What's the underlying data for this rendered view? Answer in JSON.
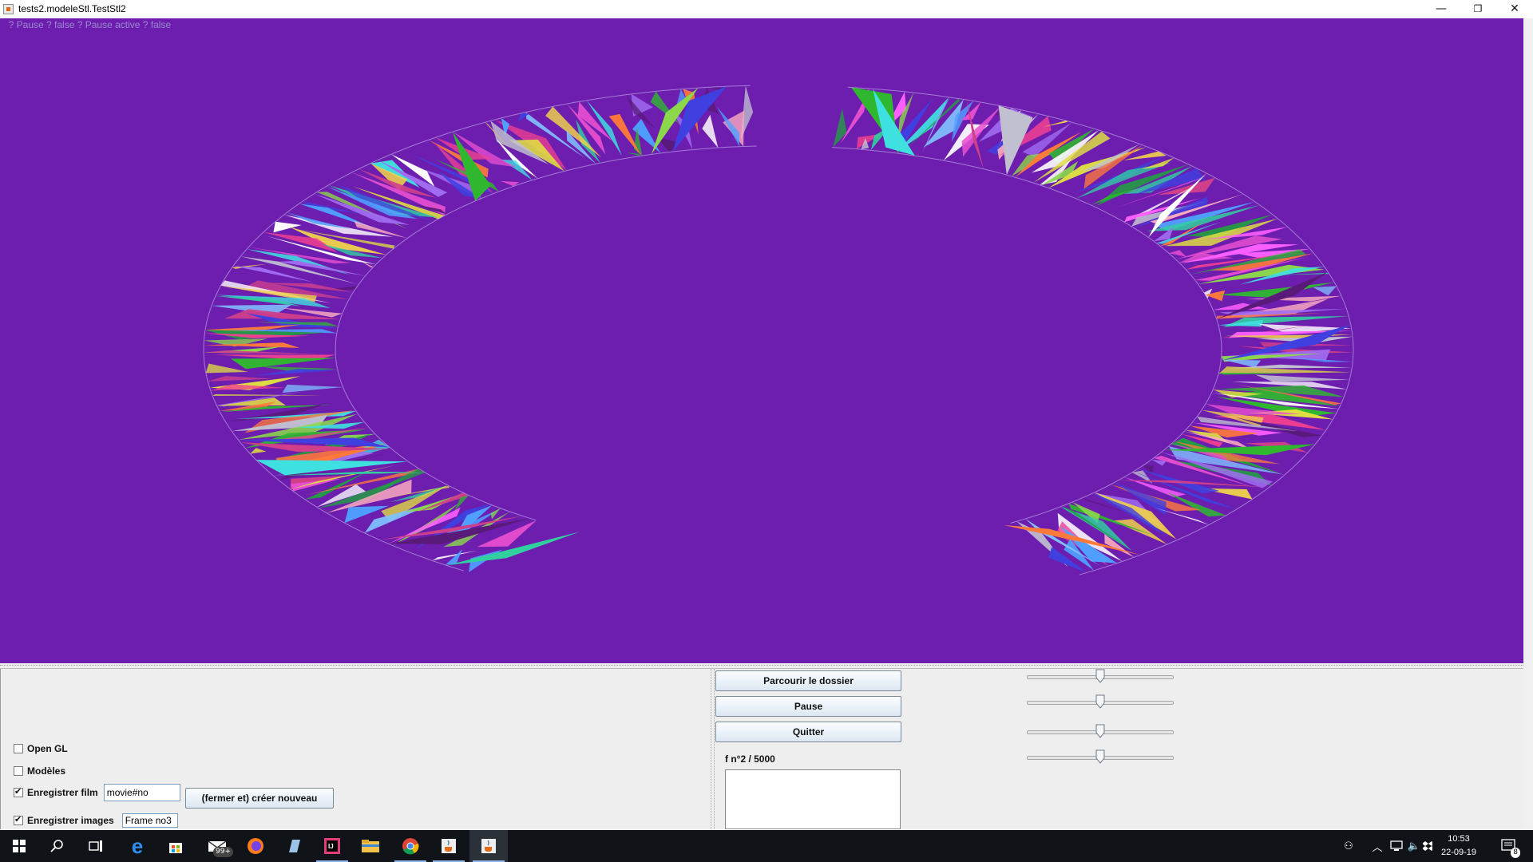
{
  "window": {
    "title": "tests2.modeleStl.TestStl2",
    "minimize": "—",
    "maximize": "❐",
    "close": "✕"
  },
  "canvas": {
    "background": "#6d1eaf",
    "hud_text": "  ? Pause ? false ? Pause active ? false"
  },
  "panel": {
    "checkboxes": [
      {
        "label": "Open GL",
        "checked": false
      },
      {
        "label": "Modèles",
        "checked": false
      },
      {
        "label": "Enregistrer film",
        "checked": true
      },
      {
        "label": "Enregistrer images",
        "checked": true
      }
    ],
    "movie_field": "movie#no",
    "frame_field": "Frame no3",
    "new_button": "(fermer et) créer nouveau",
    "browse_button": "Parcourir le dossier",
    "pause_button": "Pause",
    "quit_button": "Quitter",
    "frame_counter": "f n°2 / 5000",
    "sliders": [
      0.5,
      0.5,
      0.5,
      0.5
    ]
  },
  "taskbar": {
    "mail_badge": "99+",
    "notification_count": "8",
    "time": "10:53",
    "date": "22-09-19"
  }
}
